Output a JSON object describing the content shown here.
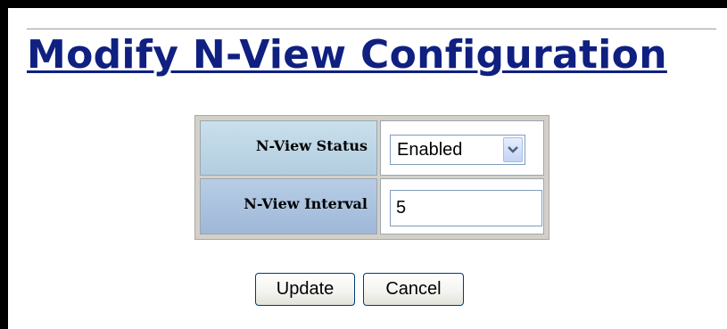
{
  "page": {
    "title": "Modify N-View Configuration"
  },
  "form": {
    "status": {
      "label": "N-View Status",
      "selected": "Enabled"
    },
    "interval": {
      "label": "N-View Interval",
      "value": "5"
    }
  },
  "buttons": {
    "update_label": "Update",
    "cancel_label": "Cancel"
  },
  "colors": {
    "title": "#0f2080",
    "label_cell_top": "#c9e0ec",
    "label_cell_bottom": "#b3cde0",
    "table_background": "#d4d0c8",
    "frame": "#000000"
  },
  "icons": {
    "dropdown": "chevron-down-icon"
  }
}
